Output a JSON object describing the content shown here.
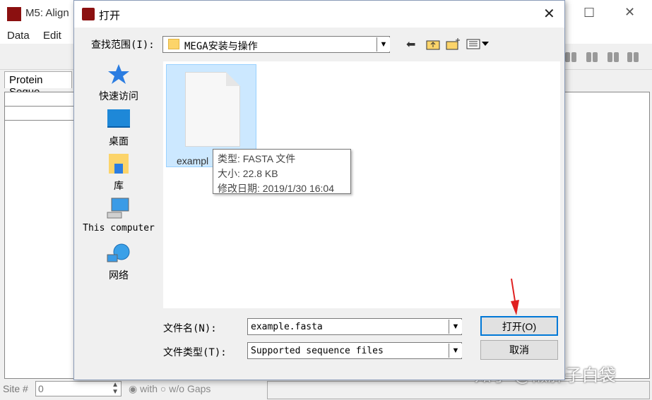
{
  "background_app": {
    "title": "M5: Align",
    "menu": [
      "Data",
      "Edit"
    ],
    "tab_label": "Protein Seque",
    "site_label": "Site #",
    "site_value": "0",
    "gaps_with": "with",
    "gaps_without": "w/o Gaps"
  },
  "dialog": {
    "title": "打开",
    "lookin_label": "查找范围(I):",
    "lookin_value": "MEGA安装与操作",
    "places": [
      {
        "label": "快速访问",
        "icon": "star-icon"
      },
      {
        "label": "桌面",
        "icon": "desktop-icon"
      },
      {
        "label": "库",
        "icon": "library-icon"
      },
      {
        "label": "This computer",
        "icon": "computer-icon"
      },
      {
        "label": "网络",
        "icon": "network-icon"
      }
    ],
    "file": {
      "name": "exampl",
      "tooltip_type": "类型: FASTA 文件",
      "tooltip_size": "大小: 22.8 KB",
      "tooltip_date": "修改日期: 2019/1/30 16:04"
    },
    "filename_label": "文件名(N):",
    "filename_value": "example.fasta",
    "filetype_label": "文件类型(T):",
    "filetype_value": "Supported sequence files",
    "open_button": "打开(O)",
    "cancel_button": "取消"
  },
  "watermark": "知乎 @懒胖子白袋",
  "colors": {
    "selection": "#cce8ff",
    "accent": "#0078d7",
    "annotation_arrow": "#e02020"
  }
}
